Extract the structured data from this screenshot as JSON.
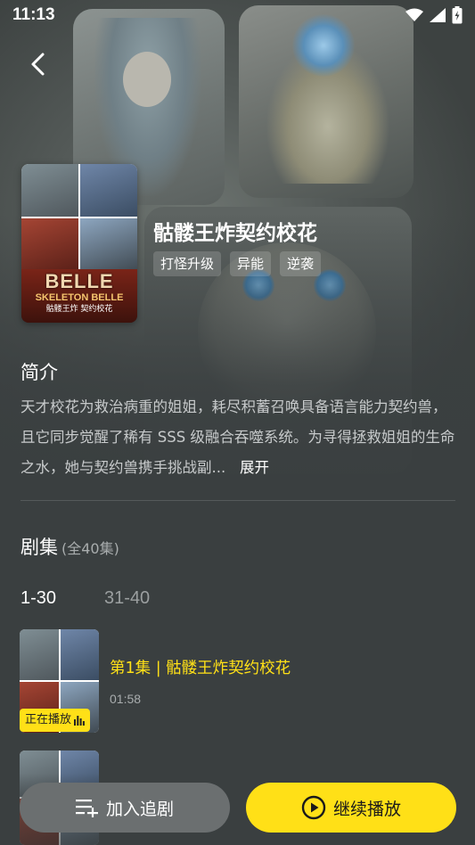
{
  "status_bar": {
    "time": "11:13"
  },
  "drama": {
    "title": "骷髅王炸契约校花",
    "tags": [
      "打怪升级",
      "异能",
      "逆袭"
    ],
    "cover": {
      "logo_line1": "BELLE",
      "logo_line2": "SKELETON BELLE",
      "logo_line3": "骷髅王炸 契约校花"
    }
  },
  "intro": {
    "heading": "简介",
    "text": "天才校花为救治病重的姐姐，耗尽积蓄召唤具备语言能力契约兽，且它同步觉醒了稀有 SSS 级融合吞噬系统。为寻得拯救姐姐的生命之水，她与契约兽携手挑战副...",
    "expand_label": "展开"
  },
  "episodes": {
    "heading": "剧集",
    "count_label": "(全40集)",
    "ranges": [
      "1-30",
      "31-40"
    ],
    "active_range": "1-30",
    "list": [
      {
        "title": "第1集 | 骷髅王炸契约校花",
        "duration": "01:58",
        "badge": "正在播放"
      }
    ]
  },
  "actions": {
    "follow_label": "加入追剧",
    "play_label": "继续播放"
  },
  "colors": {
    "accent": "#ffe017",
    "background": "#3a3f40"
  }
}
